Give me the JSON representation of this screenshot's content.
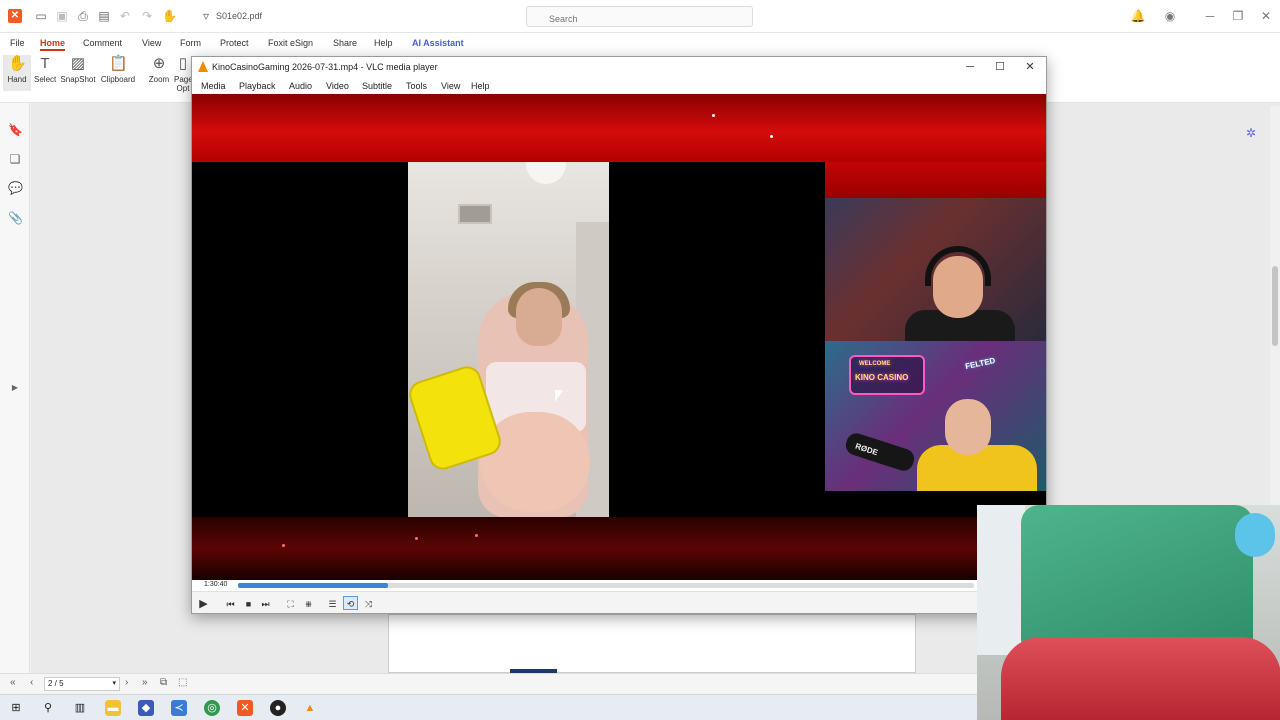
{
  "foxit": {
    "filename": "S01e02.pdf",
    "search_placeholder": "Search",
    "menu_tabs": [
      "File",
      "Home",
      "Comment",
      "View",
      "Form",
      "Protect",
      "Foxit eSign",
      "Share",
      "Help",
      "AI Assistant"
    ],
    "active_tab": "Home",
    "ribbon": [
      {
        "label": "Hand",
        "icon": "hand-icon"
      },
      {
        "label": "Select",
        "icon": "select-icon"
      },
      {
        "label": "SnapShot",
        "icon": "snapshot-icon"
      },
      {
        "label": "Clipboard",
        "icon": "clipboard-icon"
      },
      {
        "label": "Zoom",
        "icon": "zoom-icon"
      },
      {
        "label": "Page Opt",
        "icon": "page-icon"
      }
    ],
    "page_indicator": "2 / 5"
  },
  "vlc": {
    "title": "KinoCasinoGaming 2026-07-31.mp4 - VLC media player",
    "menu": [
      "Media",
      "Playback",
      "Audio",
      "Video",
      "Subtitle",
      "Tools",
      "View",
      "Help"
    ],
    "elapsed": "1:30:40",
    "progress": 0.204,
    "video_text": {
      "cam2_sign": "KINO CASINO",
      "cam2_felted": "FELTED",
      "cam2_mic": "RØDE",
      "cam2_welcome": "WELCOME"
    }
  },
  "colors": {
    "foxit_accent": "#c8390c",
    "ai_accent": "#4a5bd6",
    "vlc_seek": "#3b87d4",
    "video_red": "#d40b0b"
  }
}
